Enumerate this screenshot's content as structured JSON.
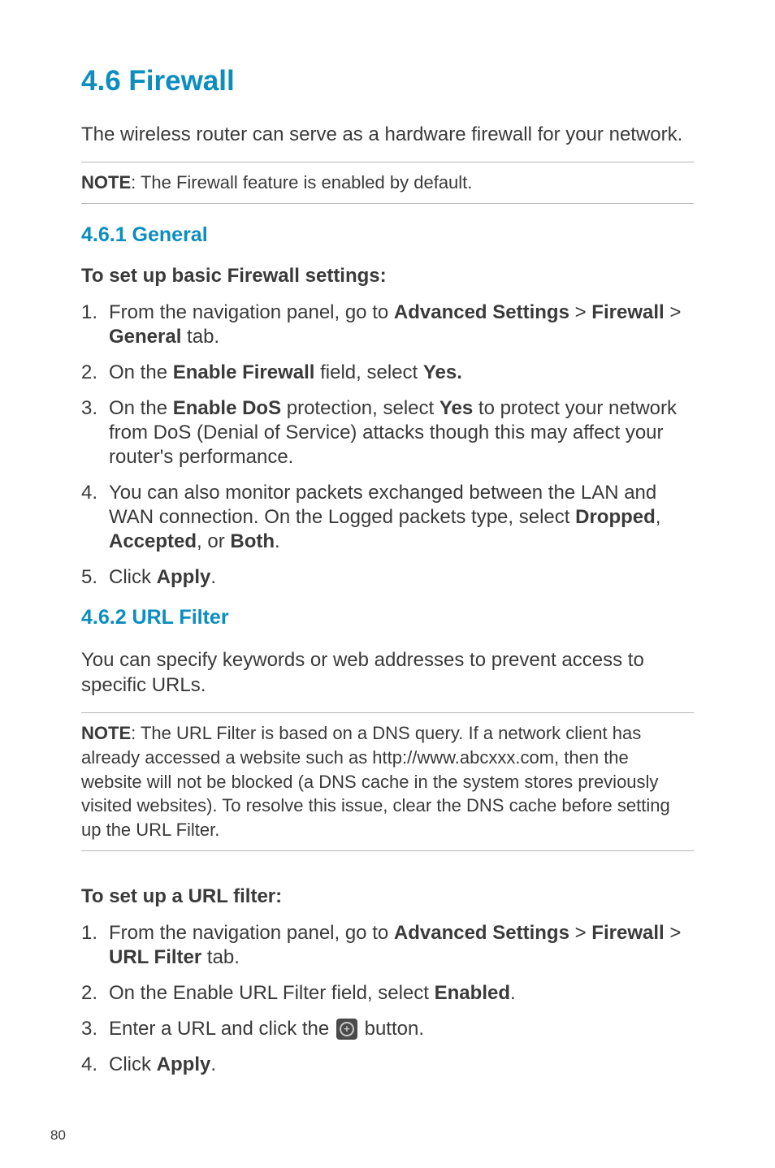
{
  "section": {
    "title": "4.6    Firewall",
    "intro": "The wireless router can serve as a hardware firewall for your network.",
    "note1_label": "NOTE",
    "note1_text": ":  The Firewall feature is enabled by default."
  },
  "sub461": {
    "title": "4.6.1 General",
    "heading": "To set up basic Firewall settings:",
    "steps": {
      "s1_a": "From the navigation panel, go to ",
      "s1_b": "Advanced Settings",
      "s1_c": " > ",
      "s1_d": "Firewall",
      "s1_e": " > ",
      "s1_f": "General",
      "s1_g": " tab.",
      "s2_a": "On the ",
      "s2_b": "Enable Firewall",
      "s2_c": " field, select ",
      "s2_d": "Yes.",
      "s3_a": "On the ",
      "s3_b": "Enable DoS",
      "s3_c": " protection, select ",
      "s3_d": "Yes",
      "s3_e": " to protect your network from DoS (Denial of Service) attacks though this may affect your router's performance.",
      "s4_a": "You can also monitor packets exchanged between the LAN and WAN connection. On the Logged packets type, select ",
      "s4_b": "Dropped",
      "s4_c": ", ",
      "s4_d": "Accepted",
      "s4_e": ", or ",
      "s4_f": "Both",
      "s4_g": ".",
      "s5_a": "Click ",
      "s5_b": "Apply",
      "s5_c": "."
    }
  },
  "sub462": {
    "title": "4.6.2 URL Filter",
    "intro": "You can specify keywords or web addresses to prevent access to specific URLs.",
    "note_label": "NOTE",
    "note_text": ":  The URL Filter is based on a DNS query. If a network client has already accessed a website such as http://www.abcxxx.com, then the website will not be blocked (a DNS cache in the system stores previously visited websites). To resolve this issue, clear the DNS cache before setting up the URL Filter.",
    "heading": "To set up a URL filter:",
    "steps": {
      "s1_a": "From the navigation panel, go to ",
      "s1_b": "Advanced Settings",
      "s1_c": " > ",
      "s1_d": "Firewall",
      "s1_e": " > ",
      "s1_f": "URL Filter",
      "s1_g": " tab.",
      "s2_a": "On the Enable URL Filter field, select ",
      "s2_b": "Enabled",
      "s2_c": ".",
      "s3_a": "Enter a URL and click the ",
      "s3_b": " button.",
      "s4_a": "Click ",
      "s4_b": "Apply",
      "s4_c": "."
    }
  },
  "page_number": "80"
}
